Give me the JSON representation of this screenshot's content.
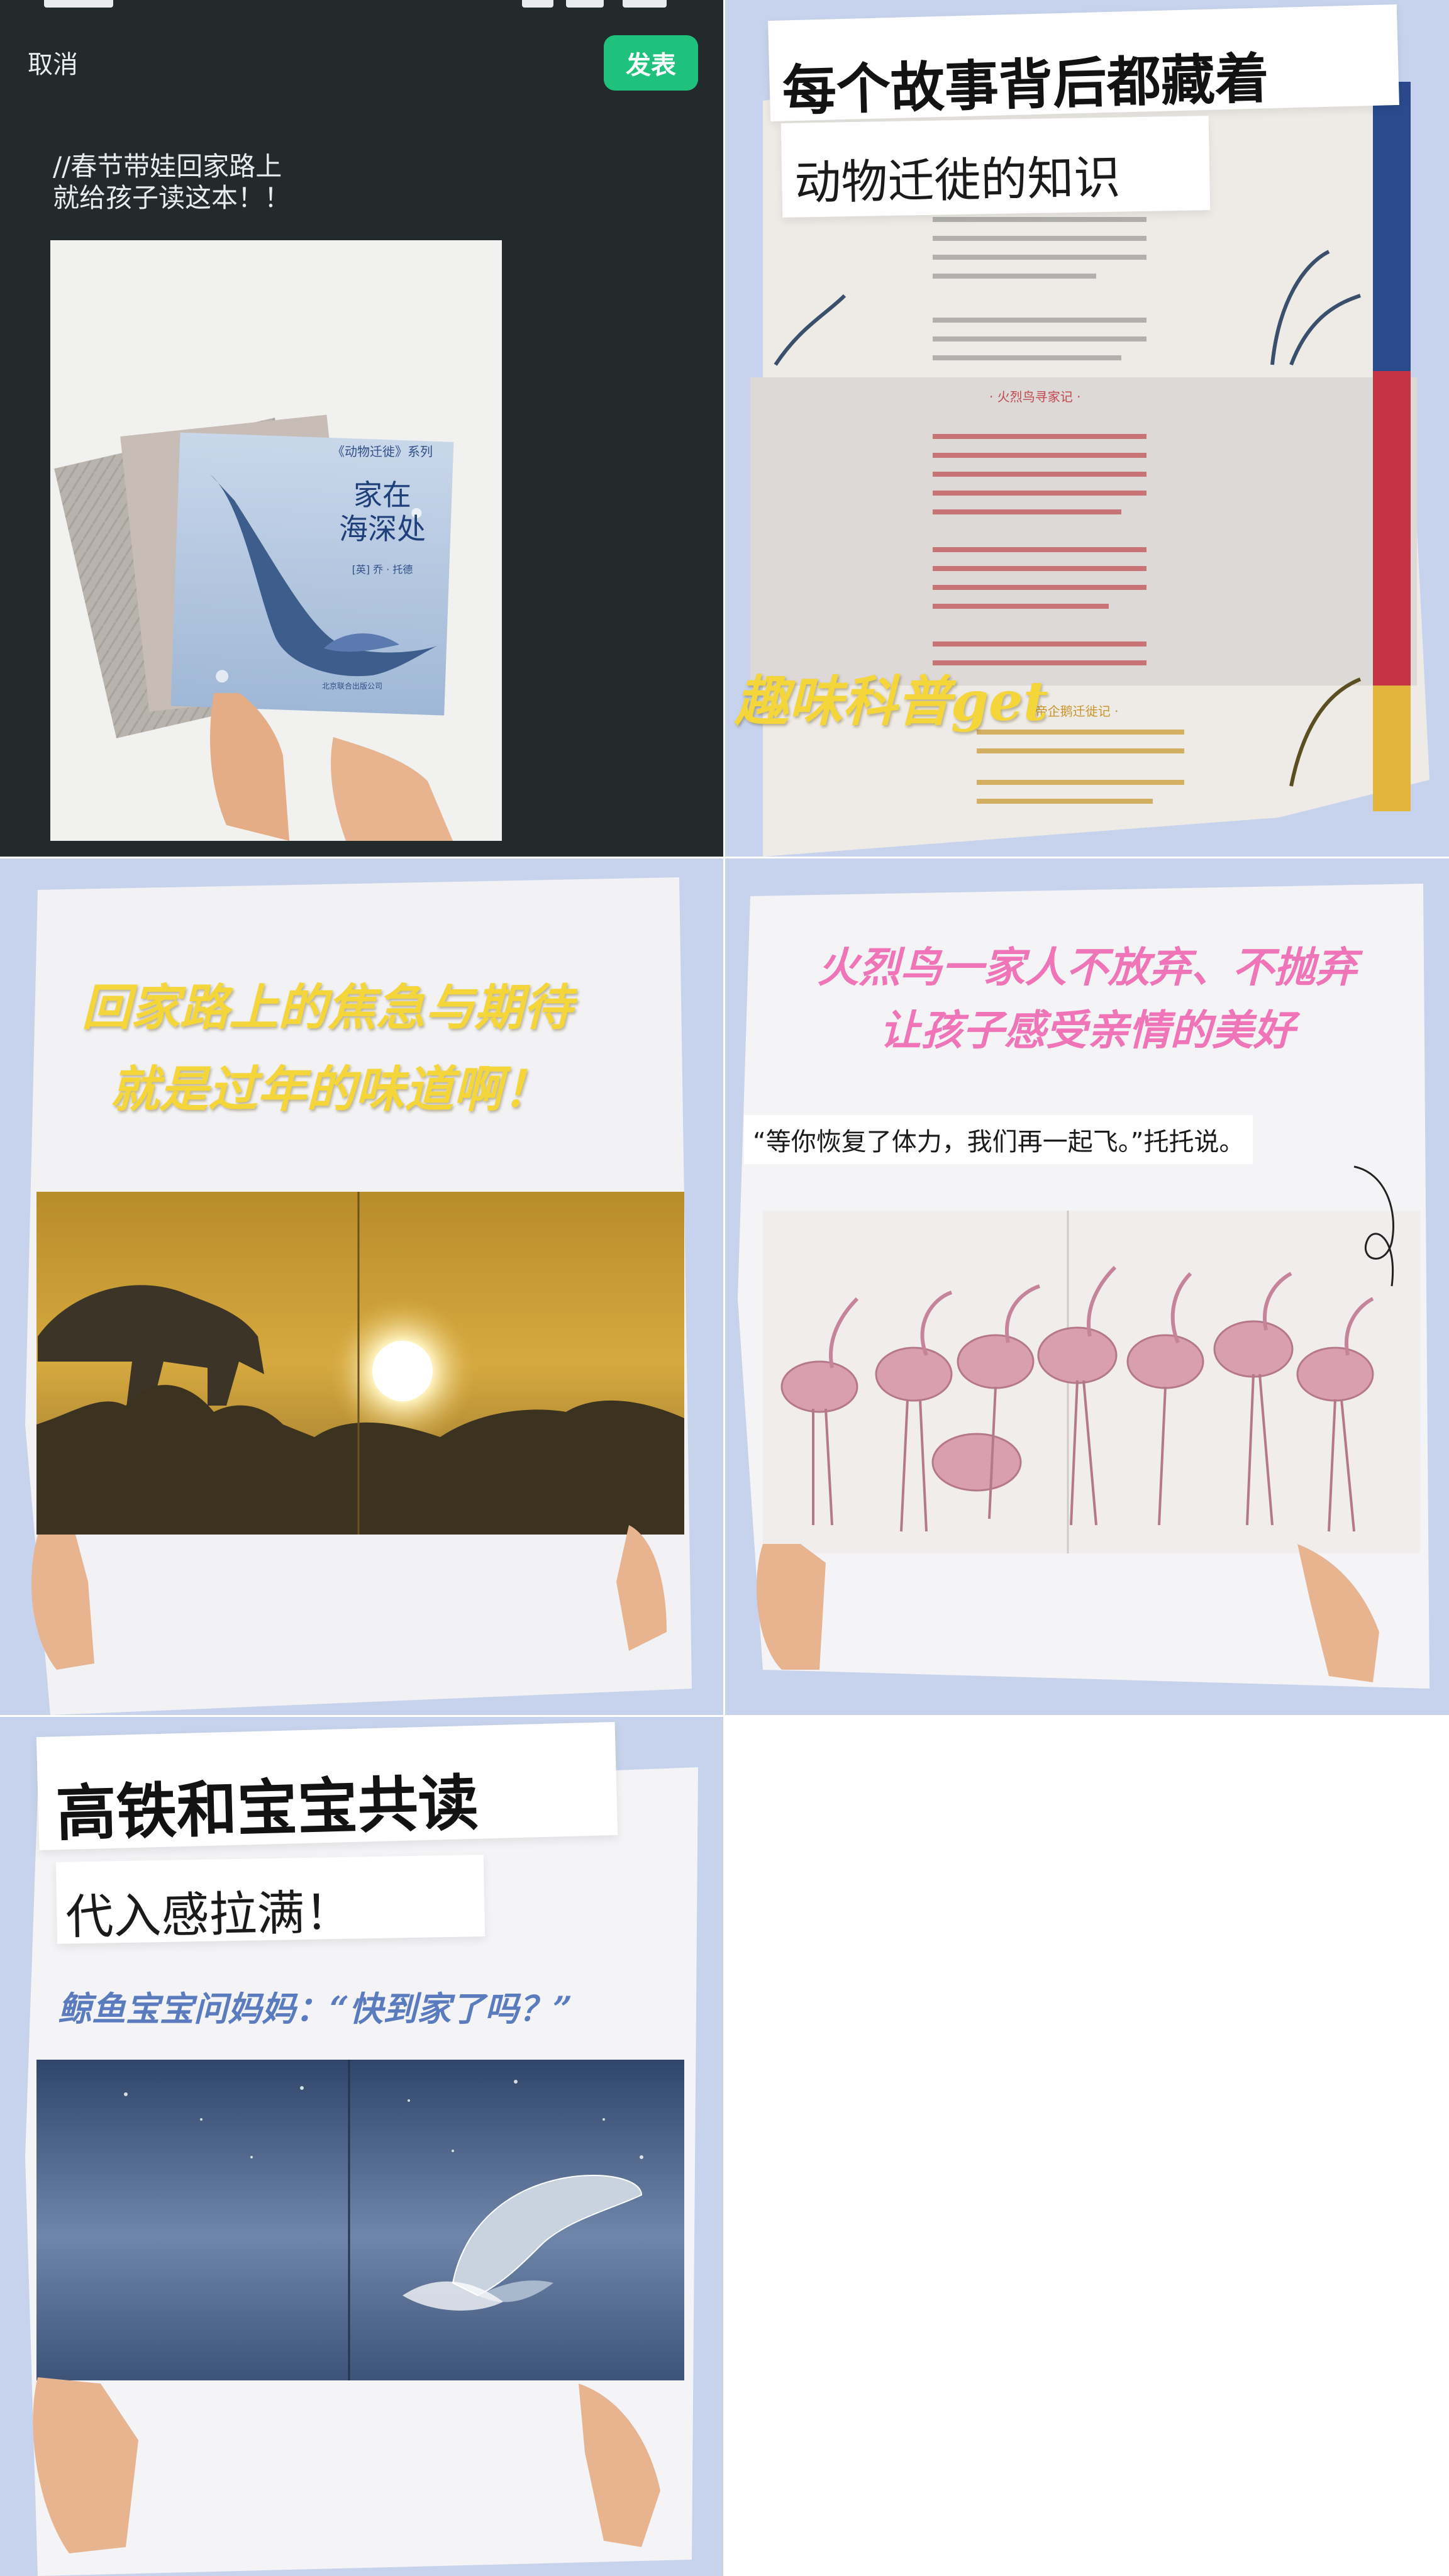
{
  "composer": {
    "cancel_label": "取消",
    "publish_label": "发表",
    "post_text_line1": "//春节带娃回家路上",
    "post_text_line2": "就给孩子读这本！！"
  },
  "cover_book": {
    "series_label": "《动物迁徙》系列",
    "title_line1": "家在",
    "title_line2": "海深处",
    "author": "[英] 乔 · 托德",
    "publisher": "北京联合出版公司"
  },
  "panel2": {
    "headline": "每个故事背后都藏着",
    "subline": "动物迁徙的知识",
    "book_section_title": "· 火烈鸟寻家记 ·",
    "book_section_title2": "· 帝企鹅迁徙记 ·",
    "overlay": "趣味科普get"
  },
  "panel3": {
    "line1": "回家路上的焦急与期待",
    "line2": "就是过年的味道啊！"
  },
  "panel4": {
    "line1": "火烈鸟一家人不放弃、不抛弃",
    "line2": "让孩子感受亲情的美好",
    "quote": "“等你恢复了体力，我们再一起飞。”托托说。"
  },
  "panel5": {
    "headline": "高铁和宝宝共读",
    "subline": "代入感拉满！",
    "quote": "鲸鱼宝宝问妈妈：“快到家了吗？”"
  },
  "colors": {
    "dark_bg": "#222a2b",
    "accent_green": "#1ec27c",
    "lavender_bg": "#c7d3ec",
    "yellow_text": "#f4d63a",
    "pink_text": "#ef74b8",
    "blue_text": "#5b7bbf"
  },
  "icons": [
    "flamingo-illustration",
    "whale-illustration",
    "leopard-illustration",
    "sun-illustration"
  ]
}
